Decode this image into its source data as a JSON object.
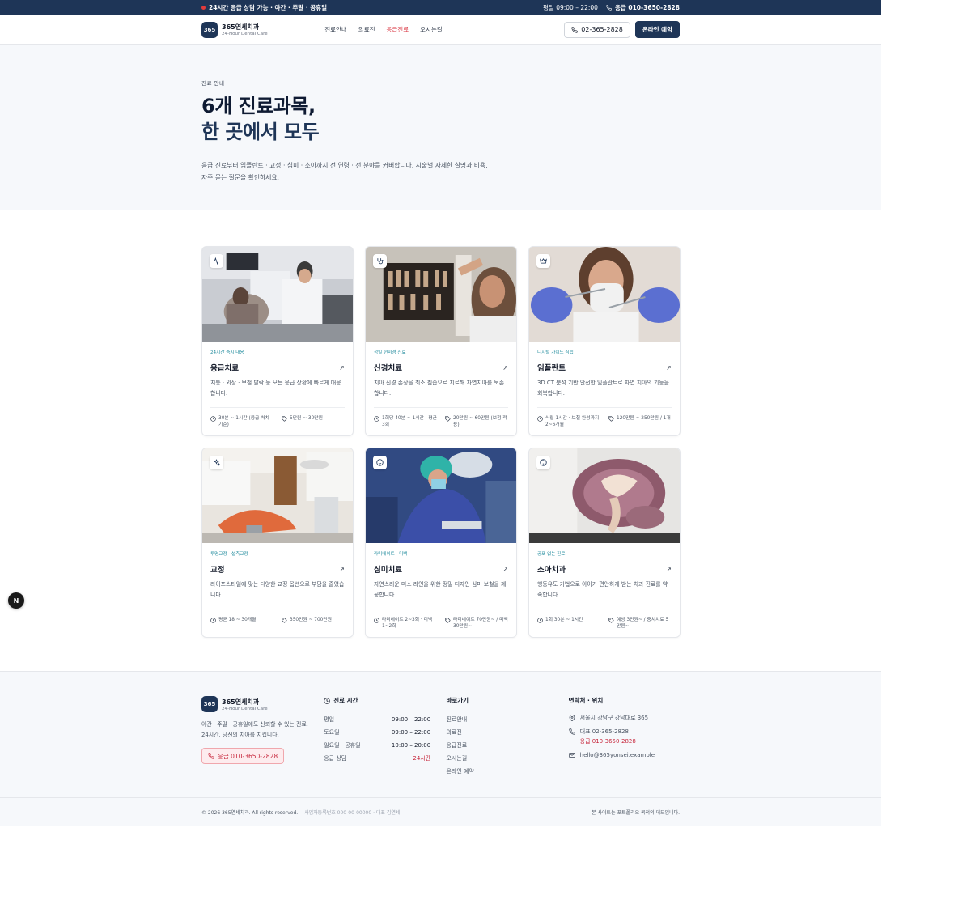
{
  "topbar": {
    "notice": "24시간 응급 상담 가능 · 야간 · 주말 · 공휴일",
    "hours": "평일 09:00 – 22:00",
    "emergency": "응급 010-3650-2828"
  },
  "header": {
    "logo": "365",
    "brand_name": "365연세치과",
    "brand_sub": "24-Hour Dental Care",
    "nav": [
      "진료안내",
      "의료진",
      "응급진료",
      "오시는길"
    ],
    "phone": "02-365-2828",
    "book": "온라인 예약"
  },
  "hero": {
    "eyebrow": "진료 안내",
    "title_1": "6개 진료과목,",
    "title_2": "한 곳에서 모두",
    "desc": "응급 진료부터 임플란트 · 교정 · 심미 · 소아까지 전 연령 · 전 분야를 커버합니다. 시술별 자세한 설명과 비용, 자주 묻는 질문을 확인하세요."
  },
  "cards": [
    {
      "tag": "24시간 즉시 대응",
      "title": "응급치료",
      "desc": "치통 · 외상 · 보철 탈락 등 모든 응급 상황에 빠르게 대응합니다.",
      "time": "30분 ~ 1시간 (응급 처치 기준)",
      "price": "5만원 ~ 30만원",
      "icon": "activity-icon"
    },
    {
      "tag": "정밀 현미경 진료",
      "title": "신경치료",
      "desc": "치아 신경 손상을 최소 침습으로 치료해 자연치아를 보존합니다.",
      "time": "1회당 40분 ~ 1시간 · 평균 3회",
      "price": "20만원 ~ 60만원 (보험 적용)",
      "icon": "stethoscope-icon"
    },
    {
      "tag": "디지털 가이드 식립",
      "title": "임플란트",
      "desc": "3D CT 분석 기반 안전한 임플란트로 자연 치아의 기능을 회복합니다.",
      "time": "식립 1시간 · 보철 완성까지 2~6개월",
      "price": "120만원 ~ 250만원 / 1개",
      "icon": "crown-icon"
    },
    {
      "tag": "투명교정 · 설측교정",
      "title": "교정",
      "desc": "라이프스타일에 맞는 다양한 교정 옵션으로 부담을 줄였습니다.",
      "time": "평균 18 ~ 30개월",
      "price": "350만원 ~ 700만원",
      "icon": "sparkles-icon"
    },
    {
      "tag": "라미네이트 · 미백",
      "title": "심미치료",
      "desc": "자연스러운 미소 라인을 위한 정밀 디자인 심미 보철을 제공합니다.",
      "time": "라미네이트 2~3회 · 미백 1~2회",
      "price": "라미네이트 70만원~ / 미백 30만원~",
      "icon": "smile-icon"
    },
    {
      "tag": "공포 없는 진료",
      "title": "소아치과",
      "desc": "행동유도 기법으로 아이가 편안하게 받는 치과 진료를 약속합니다.",
      "time": "1회 30분 ~ 1시간",
      "price": "예방 3만원~ / 충치치료 5만원~",
      "icon": "baby-icon"
    }
  ],
  "float_button": "N",
  "footer": {
    "logo": "365",
    "brand_name": "365연세치과",
    "brand_sub": "24-Hour Dental Care",
    "desc": "야간 · 주말 · 공휴일에도 신뢰할 수 있는 진료. 24시간, 당신의 치아를 지킵니다.",
    "emergency": "응급 010-3650-2828",
    "hours_title": "진료 시간",
    "hours": [
      {
        "day": "평일",
        "time": "09:00 – 22:00"
      },
      {
        "day": "토요일",
        "time": "09:00 – 22:00"
      },
      {
        "day": "일요일 · 공휴일",
        "time": "10:00 – 20:00"
      },
      {
        "day": "응급 상담",
        "time": "24시간"
      }
    ],
    "links_title": "바로가기",
    "links": [
      "진료안내",
      "의료진",
      "응급진료",
      "오시는길",
      "온라인 예약"
    ],
    "contact_title": "연락처 · 위치",
    "address": "서울시 강남구 강남대로 365",
    "tel_main": "대표 02-365-2828",
    "tel_emergency": "응급 010-3650-2828",
    "email": "hello@365yonsei.example",
    "copyright": "© 2026 365연세치과. All rights reserved.",
    "biz": "사업자등록번호 000-00-00000 · 대표 김연세",
    "disclaimer": "본 사이트는 포트폴리오 목적의 데모입니다."
  },
  "colors": {
    "navy": "#1e3557",
    "accent_red": "#d9333f",
    "teal_tag": "#1f8a9c",
    "hero_bg": "#f6f8fb"
  }
}
